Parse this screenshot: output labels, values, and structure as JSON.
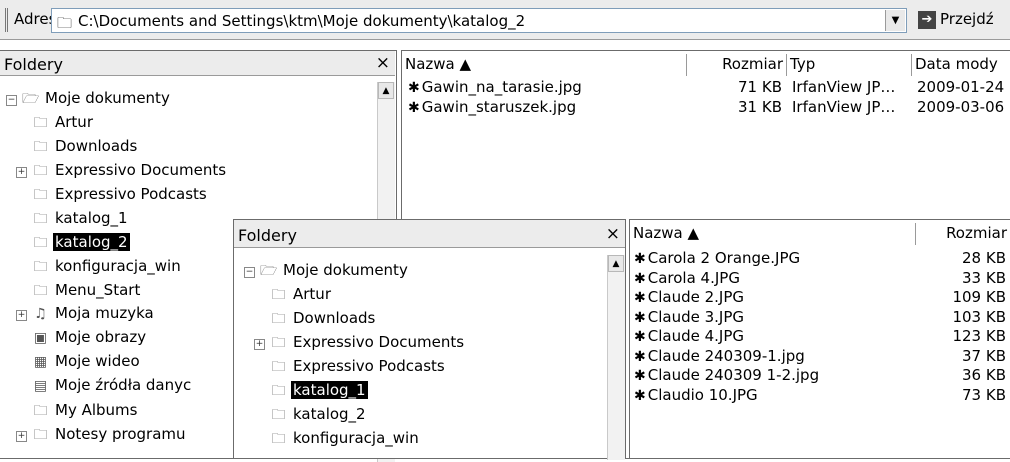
{
  "address_bar": {
    "label": "Adres",
    "path": "C:\\Documents and Settings\\ktm\\Moje dokumenty\\katalog_2",
    "go_label": "Przejdź"
  },
  "back_pane": {
    "title": "Foldery",
    "close": "×",
    "tree": [
      {
        "label": "Moje dokumenty",
        "expander": "⊟",
        "icon": "documents-icon",
        "selected": false
      },
      {
        "label": "Artur",
        "expander": "",
        "icon": "folder-icon",
        "selected": false
      },
      {
        "label": "Downloads",
        "expander": "",
        "icon": "folder-icon",
        "selected": false
      },
      {
        "label": "Expressivo Documents",
        "expander": "⊞",
        "icon": "expressivo-folder-icon",
        "selected": false
      },
      {
        "label": "Expressivo Podcasts",
        "expander": "",
        "icon": "expressivo-folder-icon",
        "selected": false
      },
      {
        "label": "katalog_1",
        "expander": "",
        "icon": "folder-icon",
        "selected": false
      },
      {
        "label": "katalog_2",
        "expander": "",
        "icon": "folder-icon",
        "selected": true
      },
      {
        "label": "konfiguracja_win",
        "expander": "",
        "icon": "folder-icon",
        "selected": false
      },
      {
        "label": "Menu_Start",
        "expander": "",
        "icon": "folder-icon",
        "selected": false
      },
      {
        "label": "Moja muzyka",
        "expander": "⊞",
        "icon": "music-folder-icon",
        "selected": false
      },
      {
        "label": "Moje obrazy",
        "expander": "",
        "icon": "pictures-folder-icon",
        "selected": false
      },
      {
        "label": "Moje wideo",
        "expander": "",
        "icon": "video-folder-icon",
        "selected": false
      },
      {
        "label": "Moje źródła danyc",
        "expander": "",
        "icon": "data-sources-folder-icon",
        "selected": false
      },
      {
        "label": "My Albums",
        "expander": "",
        "icon": "folder-icon",
        "selected": false
      },
      {
        "label": "Notesy programu",
        "expander": "⊞",
        "icon": "folder-icon",
        "selected": false
      }
    ],
    "columns": [
      "Nazwa ▲",
      "Rozmiar",
      "Typ",
      "Data mody"
    ],
    "files": [
      {
        "name": "Gawin_na_tarasie.jpg",
        "size": "71 KB",
        "type": "IrfanView JP…",
        "date": "2009-01-24"
      },
      {
        "name": "Gawin_staruszek.jpg",
        "size": "31 KB",
        "type": "IrfanView JP…",
        "date": "2009-03-06"
      }
    ]
  },
  "front_pane": {
    "title": "Foldery",
    "close": "×",
    "tree": [
      {
        "label": "Moje dokumenty",
        "expander": "⊟",
        "icon": "documents-icon",
        "selected": false
      },
      {
        "label": "Artur",
        "expander": "",
        "icon": "folder-icon",
        "selected": false
      },
      {
        "label": "Downloads",
        "expander": "",
        "icon": "folder-icon",
        "selected": false
      },
      {
        "label": "Expressivo Documents",
        "expander": "⊞",
        "icon": "expressivo-folder-icon",
        "selected": false
      },
      {
        "label": "Expressivo Podcasts",
        "expander": "",
        "icon": "expressivo-folder-icon",
        "selected": false
      },
      {
        "label": "katalog_1",
        "expander": "",
        "icon": "folder-icon",
        "selected": true
      },
      {
        "label": "katalog_2",
        "expander": "",
        "icon": "folder-icon",
        "selected": false
      },
      {
        "label": "konfiguracja_win",
        "expander": "",
        "icon": "folder-icon",
        "selected": false
      }
    ],
    "columns": [
      "Nazwa ▲",
      "Rozmiar"
    ],
    "files": [
      {
        "name": "Carola 2 Orange.JPG",
        "size": "28 KB"
      },
      {
        "name": "Carola 4.JPG",
        "size": "33 KB"
      },
      {
        "name": "Claude 2.JPG",
        "size": "109 KB"
      },
      {
        "name": "Claude 3.JPG",
        "size": "103 KB"
      },
      {
        "name": "Claude 4.JPG",
        "size": "123 KB"
      },
      {
        "name": "Claude 240309-1.jpg",
        "size": "37 KB"
      },
      {
        "name": "Claude 240309 1-2.jpg",
        "size": "36 KB"
      },
      {
        "name": "Claudio 10.JPG",
        "size": "73 KB"
      }
    ]
  },
  "icons": {
    "folder-icon": "🗀",
    "documents-icon": "🗁",
    "expressivo-folder-icon": "🗀",
    "music-folder-icon": "♫",
    "pictures-folder-icon": "▣",
    "video-folder-icon": "▦",
    "data-sources-folder-icon": "▤",
    "image-file-icon": "✱"
  }
}
